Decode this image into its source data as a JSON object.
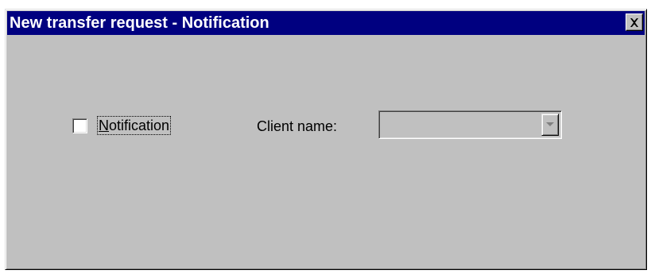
{
  "window": {
    "title": "New transfer request - Notification",
    "close_icon": "close-icon"
  },
  "form": {
    "notification_mnemonic": "N",
    "notification_rest": "otification",
    "notification_checked": false,
    "client_name_label": "Client name:",
    "client_name_value": "",
    "client_name_enabled": false,
    "dropdown_icon": "chevron-down-icon"
  },
  "colors": {
    "titlebar": "#000080",
    "face": "#c0c0c0",
    "disabled_text": "#808080"
  }
}
